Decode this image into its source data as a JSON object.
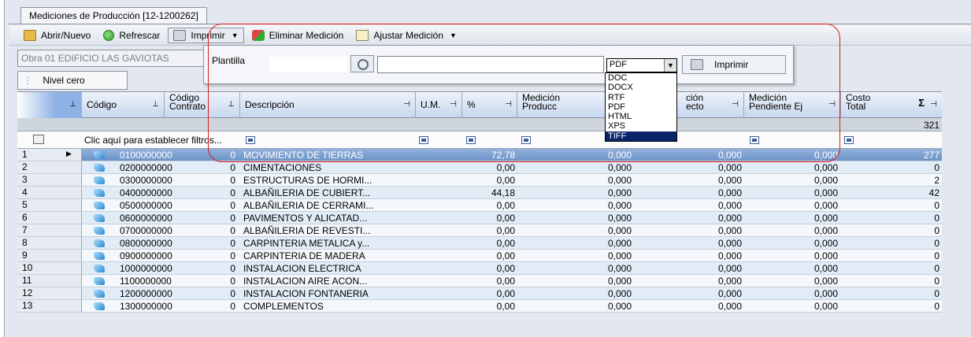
{
  "window": {
    "tab_title": "Mediciones de Producción [12-1200262]"
  },
  "toolbar": {
    "open_new": "Abrir/Nuevo",
    "refresh": "Refrescar",
    "print": "Imprimir",
    "delete_measure": "Eliminar Medición",
    "adjust_measure": "Ajustar Medición"
  },
  "obra_field": "Obra 01 EDIFICIO LAS GAVIOTAS",
  "level_button": "Nivel cero",
  "print_popup": {
    "template_label": "Plantilla",
    "template_value": "",
    "format_selected": "PDF",
    "print_button": "Imprimir",
    "format_options": [
      "DOC",
      "DOCX",
      "RTF",
      "PDF",
      "HTML",
      "XPS",
      "TIFF"
    ],
    "highlighted_option": "TIFF"
  },
  "columns": {
    "codigo": "Código",
    "codigo_contrato_1": "Código",
    "codigo_contrato_2": "Contrato",
    "descripcion": "Descripción",
    "um": "U.M.",
    "pct": "%",
    "med_prod_1": "Medición",
    "med_prod_2": "Producc",
    "med_proy_1": "ción",
    "med_proy_2": "ecto",
    "med_pend_1": "Medición",
    "med_pend_2": "Pendiente Ej",
    "costo_1": "Costo",
    "costo_2": "Total",
    "sigma": "Σ"
  },
  "group_total": "321",
  "filter_text": "Clic aquí para establecer filtros...",
  "rows": [
    {
      "n": "1",
      "code": "0100000000",
      "contract": "0",
      "desc": "MOVIMIENTO DE TIERRAS",
      "pct": "72,78",
      "mp": "0,000",
      "mpr": "0,000",
      "mpe": "0,000",
      "cost": "277"
    },
    {
      "n": "2",
      "code": "0200000000",
      "contract": "0",
      "desc": "CIMENTACIONES",
      "pct": "0,00",
      "mp": "0,000",
      "mpr": "0,000",
      "mpe": "0,000",
      "cost": "0"
    },
    {
      "n": "3",
      "code": "0300000000",
      "contract": "0",
      "desc": "ESTRUCTURAS DE HORMI...",
      "pct": "0,00",
      "mp": "0,000",
      "mpr": "0,000",
      "mpe": "0,000",
      "cost": "2"
    },
    {
      "n": "4",
      "code": "0400000000",
      "contract": "0",
      "desc": "ALBAÑILERIA DE CUBIERT...",
      "pct": "44,18",
      "mp": "0,000",
      "mpr": "0,000",
      "mpe": "0,000",
      "cost": "42"
    },
    {
      "n": "5",
      "code": "0500000000",
      "contract": "0",
      "desc": "ALBAÑILERIA DE CERRAMI...",
      "pct": "0,00",
      "mp": "0,000",
      "mpr": "0,000",
      "mpe": "0,000",
      "cost": "0"
    },
    {
      "n": "6",
      "code": "0600000000",
      "contract": "0",
      "desc": "PAVIMENTOS Y ALICATAD...",
      "pct": "0,00",
      "mp": "0,000",
      "mpr": "0,000",
      "mpe": "0,000",
      "cost": "0"
    },
    {
      "n": "7",
      "code": "0700000000",
      "contract": "0",
      "desc": "ALBAÑILERIA DE REVESTI...",
      "pct": "0,00",
      "mp": "0,000",
      "mpr": "0,000",
      "mpe": "0,000",
      "cost": "0"
    },
    {
      "n": "8",
      "code": "0800000000",
      "contract": "0",
      "desc": "CARPINTERIA METALICA y...",
      "pct": "0,00",
      "mp": "0,000",
      "mpr": "0,000",
      "mpe": "0,000",
      "cost": "0"
    },
    {
      "n": "9",
      "code": "0900000000",
      "contract": "0",
      "desc": "CARPINTERIA DE MADERA",
      "pct": "0,00",
      "mp": "0,000",
      "mpr": "0,000",
      "mpe": "0,000",
      "cost": "0"
    },
    {
      "n": "10",
      "code": "1000000000",
      "contract": "0",
      "desc": "INSTALACION ELECTRICA",
      "pct": "0,00",
      "mp": "0,000",
      "mpr": "0,000",
      "mpe": "0,000",
      "cost": "0"
    },
    {
      "n": "11",
      "code": "1100000000",
      "contract": "0",
      "desc": "INSTALACION AIRE ACON...",
      "pct": "0,00",
      "mp": "0,000",
      "mpr": "0,000",
      "mpe": "0,000",
      "cost": "0"
    },
    {
      "n": "12",
      "code": "1200000000",
      "contract": "0",
      "desc": "INSTALACION FONTANERIA",
      "pct": "0,00",
      "mp": "0,000",
      "mpr": "0,000",
      "mpe": "0,000",
      "cost": "0"
    },
    {
      "n": "13",
      "code": "1300000000",
      "contract": "0",
      "desc": "COMPLEMENTOS",
      "pct": "0,00",
      "mp": "0,000",
      "mpr": "0,000",
      "mpe": "0,000",
      "cost": "0"
    }
  ],
  "colors": {
    "selected_row": "#7a9dd0",
    "highlight_box": "#e21b1b",
    "menu_highlight": "#0a246a"
  }
}
